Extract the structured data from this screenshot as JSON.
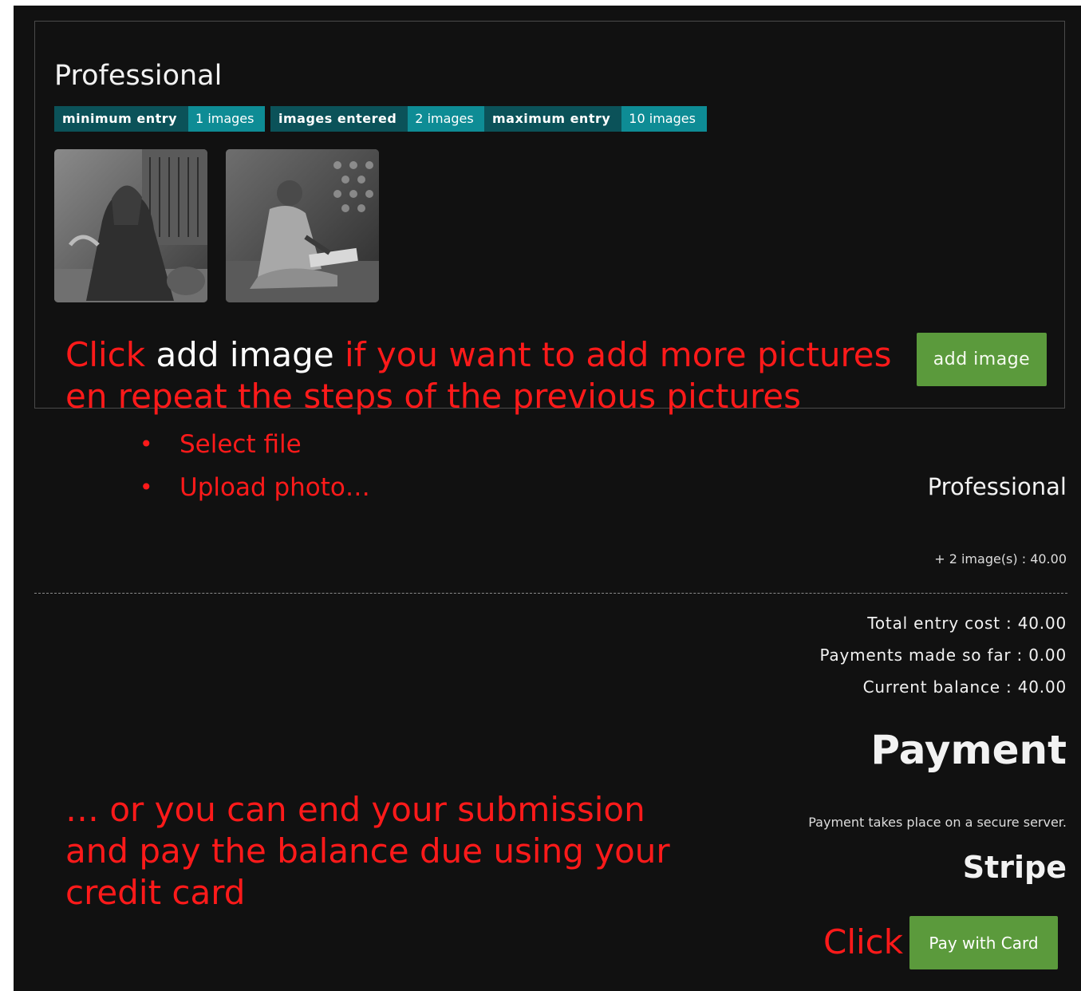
{
  "category": {
    "title": "Professional",
    "badges": [
      {
        "label": "minimum entry",
        "value": "1 images"
      },
      {
        "label": "images entered",
        "value": "2 images"
      },
      {
        "label": "maximum entry",
        "value": "10 images"
      }
    ],
    "thumbnails": [
      "photo-elderly-woman",
      "photo-girl-writing"
    ],
    "add_image_label": "add image"
  },
  "annotations": {
    "click": "Click",
    "add_image_highlight": "add image",
    "line1_rest": "if you want to add more pictures",
    "line2": "en repeat the steps of the previous pictures",
    "bullets": [
      "Select file",
      "Upload photo…"
    ],
    "end_submission_lines": [
      "… or you can end your submission",
      "and pay the balance due using your",
      "credit card"
    ],
    "click_pay": "Click"
  },
  "summary": {
    "title": "Professional",
    "line": "+ 2 image(s) : 40.00",
    "total": "Total entry cost : 40.00",
    "payments": "Payments made so far : 0.00",
    "balance": "Current balance : 40.00"
  },
  "payment": {
    "title": "Payment",
    "note": "Payment takes place on a secure server.",
    "provider": "Stripe",
    "button_label": "Pay with Card"
  },
  "colors": {
    "background": "#111111",
    "button_green": "#5b9a3c",
    "badge_label": "#0b5259",
    "badge_value": "#0e8c95",
    "annotation_red": "#ff1a1a"
  }
}
